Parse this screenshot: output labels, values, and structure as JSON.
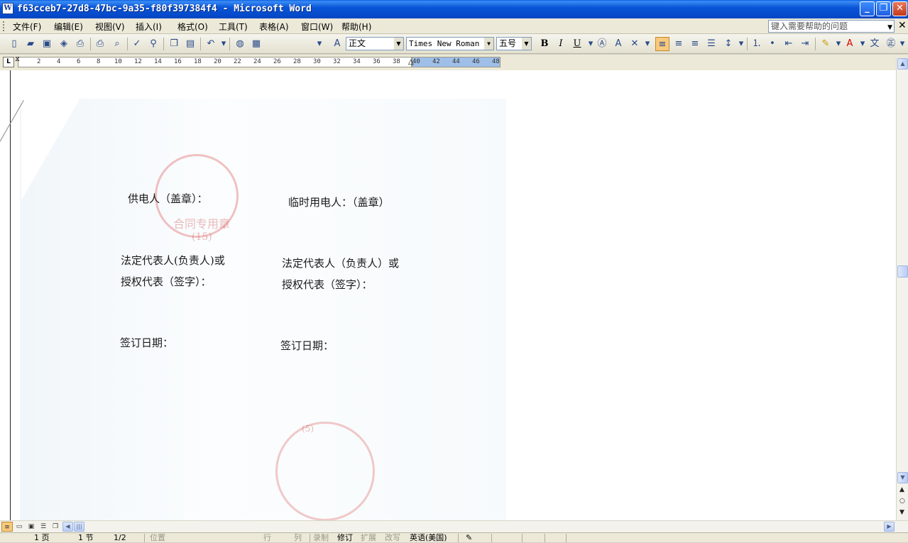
{
  "window": {
    "title": "f63cceb7-27d8-47bc-9a35-f80f397384f4 - Microsoft Word",
    "app_icon": "W",
    "minimize": "_",
    "restore": "❐",
    "close": "✕"
  },
  "menu": {
    "items": [
      "文件(F)",
      "编辑(E)",
      "视图(V)",
      "插入(I)",
      "格式(O)",
      "工具(T)",
      "表格(A)",
      "窗口(W)",
      "帮助(H)"
    ],
    "help_placeholder": "键入需要帮助的问题",
    "close": "✕"
  },
  "toolbar": {
    "style": "正文",
    "font": "Times New Roman",
    "size": "五号",
    "bold": "B",
    "italic": "I",
    "underline": "U",
    "icons": [
      "new-icon",
      "open-icon",
      "save-icon",
      "permission-icon",
      "print-icon",
      "print-preview-icon",
      "spelling-icon",
      "research-icon",
      "copy-icon",
      "paste-icon",
      "undo-icon",
      "hyperlink-icon",
      "table-icon",
      "styles-icon",
      "align-left-icon",
      "center-icon",
      "align-right-icon",
      "justify-icon",
      "line-spacing-icon",
      "numbering-icon",
      "bullets-icon",
      "decrease-indent-icon",
      "increase-indent-icon",
      "highlight-icon",
      "font-color-icon",
      "phonetic-icon",
      "enclose-characters-icon"
    ]
  },
  "ruler": {
    "ticks": [
      "2",
      "4",
      "6",
      "8",
      "10",
      "12",
      "14",
      "16",
      "18",
      "20",
      "22",
      "24",
      "26",
      "28",
      "30",
      "32",
      "34",
      "36",
      "38",
      "40",
      "42",
      "44",
      "46",
      "48"
    ]
  },
  "document": {
    "supplier_label": "供电人（盖章）：",
    "temp_user_label": "临时用电人：（盖章）",
    "legal_rep_left_line1": "法定代表人(负责人)或",
    "legal_rep_left_line2": "授权代表（签字）：",
    "legal_rep_right_line1": "法定代表人（负责人）或",
    "legal_rep_right_line2": "授权代表（签字）：",
    "sign_date_left": "签订日期：",
    "sign_date_right": "签订日期：",
    "stamp_text_1": "合同专用章",
    "stamp_text_2": "(15)",
    "stamp_text_3": "(5)"
  },
  "statusbar": {
    "page": "1 页",
    "section": "1 节",
    "page_of": "1/2",
    "position": "位置",
    "line": "行",
    "column": "列",
    "record": "录制",
    "revision": "修订",
    "extend": "扩展",
    "overtype": "改写",
    "language": "英语(美国)"
  },
  "colors": {
    "titlebar": "#0a55d8",
    "stamp": "#dc5050",
    "active_button": "#f9c97c"
  }
}
